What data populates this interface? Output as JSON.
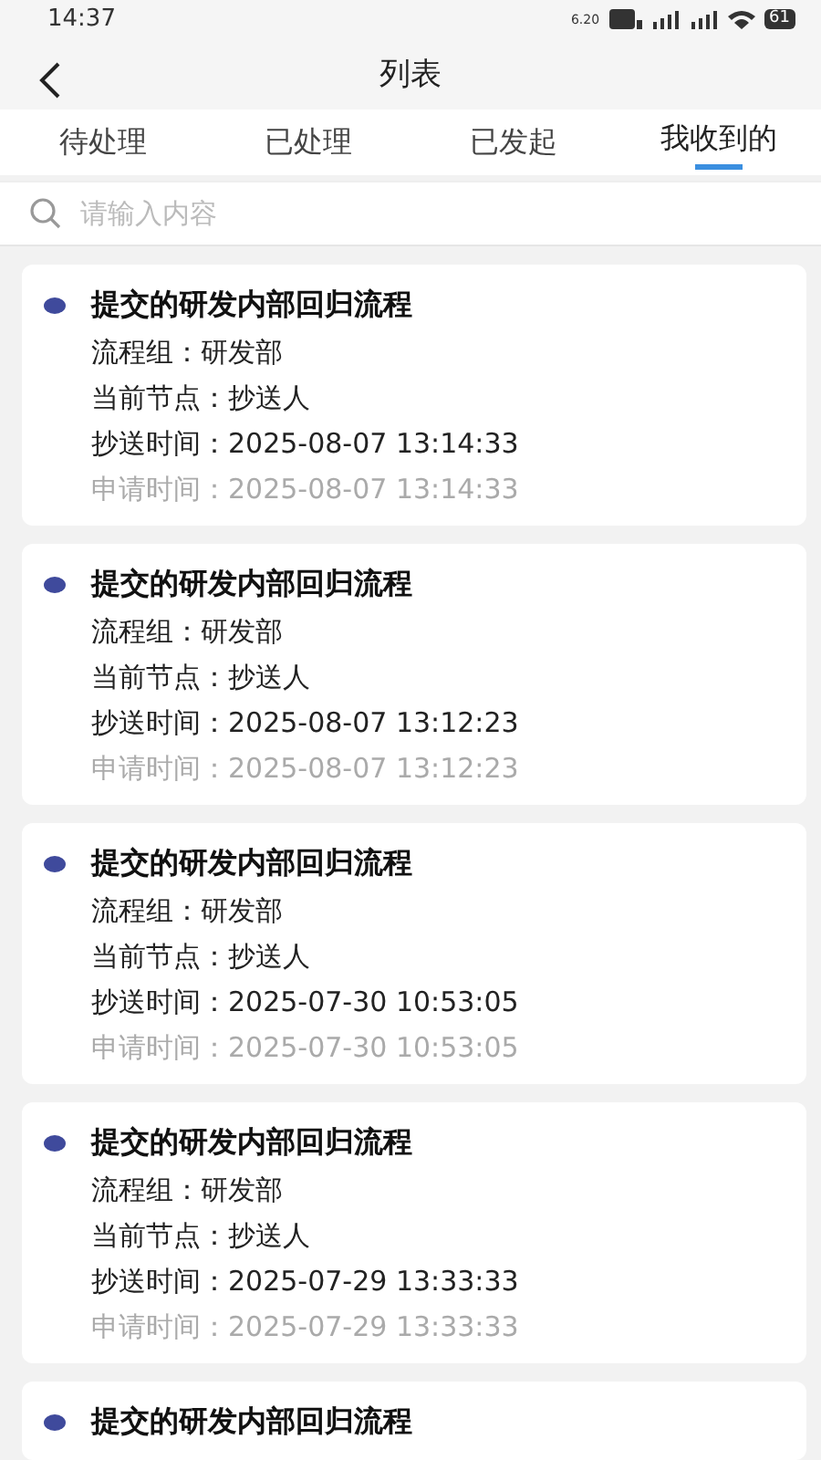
{
  "status_bar": {
    "time": "14:37",
    "speed": "6.20",
    "battery": "61"
  },
  "header": {
    "title": "列表"
  },
  "tabs": [
    {
      "label": "待处理",
      "selected": false
    },
    {
      "label": "已处理",
      "selected": false
    },
    {
      "label": "已发起",
      "selected": false
    },
    {
      "label": "我收到的",
      "selected": true
    }
  ],
  "search": {
    "placeholder": "请输入内容"
  },
  "cards": [
    {
      "title": "提交的研发内部回归流程",
      "color": "#3f4a9c",
      "lines": [
        {
          "text": "流程组：研发部",
          "kind": "plain"
        },
        {
          "text": "当前节点：抄送人",
          "kind": "plain"
        },
        {
          "text": "抄送时间：2025-08-07 13:14:33",
          "kind": "plain"
        },
        {
          "text": "申请时间：2025-08-07 13:14:33",
          "kind": "muted"
        }
      ]
    },
    {
      "title": "提交的研发内部回归流程",
      "color": "#3f4a9c",
      "lines": [
        {
          "text": "流程组：研发部",
          "kind": "plain"
        },
        {
          "text": "当前节点：抄送人",
          "kind": "plain"
        },
        {
          "text": "抄送时间：2025-08-07 13:12:23",
          "kind": "plain"
        },
        {
          "text": "申请时间：2025-08-07 13:12:23",
          "kind": "muted"
        }
      ]
    },
    {
      "title": "提交的研发内部回归流程",
      "color": "#3f4a9c",
      "lines": [
        {
          "text": "流程组：研发部",
          "kind": "plain"
        },
        {
          "text": "当前节点：抄送人",
          "kind": "plain"
        },
        {
          "text": "抄送时间：2025-07-30 10:53:05",
          "kind": "plain"
        },
        {
          "text": "申请时间：2025-07-30 10:53:05",
          "kind": "muted"
        }
      ]
    },
    {
      "title": "提交的研发内部回归流程",
      "color": "#3f4a9c",
      "lines": [
        {
          "text": "流程组：研发部",
          "kind": "plain"
        },
        {
          "text": "当前节点：抄送人",
          "kind": "plain"
        },
        {
          "text": "抄送时间：2025-07-29 13:33:33",
          "kind": "plain"
        },
        {
          "text": "申请时间：2025-07-29 13:33:33",
          "kind": "muted"
        }
      ]
    },
    {
      "title": "提交的研发内部回归流程",
      "color": "#3f4a9c"
    }
  ]
}
